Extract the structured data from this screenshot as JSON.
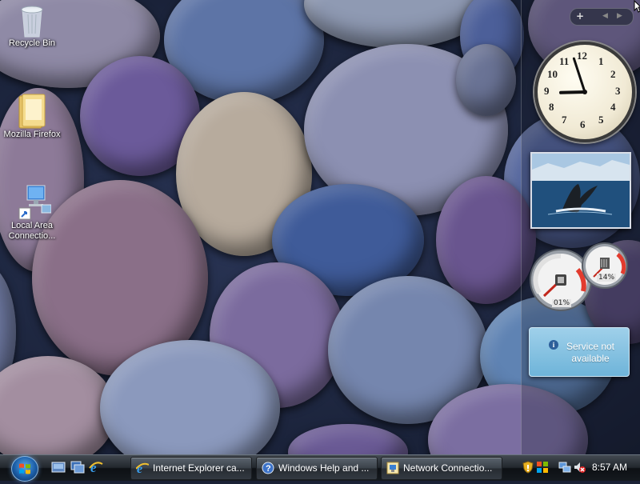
{
  "desktop": {
    "icons": [
      {
        "label": "Recycle Bin",
        "icon": "recycle-bin-icon"
      },
      {
        "label": "Mozilla Firefox",
        "icon": "folder-icon"
      },
      {
        "label_line1": "Local Area",
        "label_line2": "Connectio...",
        "icon": "network-connection-icon"
      }
    ]
  },
  "sidebar": {
    "controls": {
      "add": "+",
      "prev": "◀",
      "next": "▶"
    },
    "clock": {
      "numbers": [
        "12",
        "1",
        "2",
        "3",
        "4",
        "5",
        "6",
        "7",
        "8",
        "9",
        "10",
        "11"
      ],
      "hour": 8,
      "minute": 57
    },
    "meter": {
      "cpu_label": "01%",
      "memory_label": "14%"
    },
    "weather": {
      "info_glyph": "i",
      "message": "Service not available"
    }
  },
  "taskbar": {
    "quick_launch": [
      "show-desktop-icon",
      "switch-windows-icon",
      "internet-explorer-icon"
    ],
    "tasks": [
      {
        "label": "Internet Explorer ca...",
        "icon": "internet-explorer-icon"
      },
      {
        "label": "Windows Help and ...",
        "icon": "help-icon"
      },
      {
        "label": "Network Connectio...",
        "icon": "network-connections-icon"
      }
    ],
    "tray": {
      "icons": [
        "security-shield-icon",
        "windows-flag-icon",
        "network-icon",
        "volume-muted-icon"
      ],
      "time": "8:57 AM"
    }
  },
  "colors": {
    "accent": "#1b5da6",
    "weather_bg": "#6eb4d9",
    "taskbar": "#151a1f"
  }
}
